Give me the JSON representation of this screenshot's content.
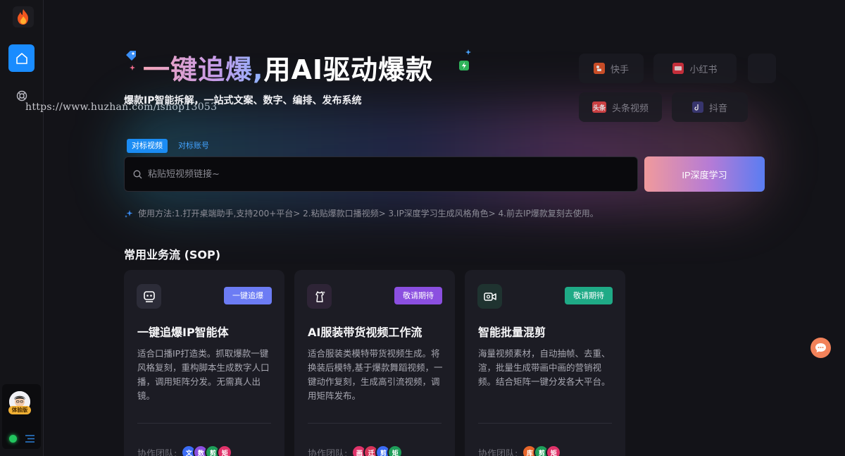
{
  "watermark": "https://www.huzhan.com/ishop13053",
  "sidebar": {
    "badge": "体验版"
  },
  "hero": {
    "title_gradient": "一键追爆,",
    "title_rest": "用AI驱动爆款",
    "subtitle": "爆款IP智能拆解，一站式文案、数字、编排、发布系统"
  },
  "platforms": [
    {
      "label": "快手",
      "icon": "kuaishou-icon",
      "color": "#e8572a"
    },
    {
      "label": "小红书",
      "icon": "xiaohongshu-icon",
      "color": "#e33340"
    },
    {
      "label": "头条视频",
      "icon": "toutiao-icon",
      "color": "#e54545"
    },
    {
      "label": "抖音",
      "icon": "douyin-icon",
      "color": "#3a3a7a"
    }
  ],
  "platform_icon_text": {
    "toutiao": "头条"
  },
  "search": {
    "tab_video": "对标视频",
    "tab_account": "对标账号",
    "placeholder": "粘贴短视频链接~",
    "button": "IP深度学习",
    "usage": "使用方法:1.打开桌端助手,支持200+平台> 2.粘贴爆款口播视频> 3.IP深度学习生成风格角色> 4.前去IP爆款复刻去使用。"
  },
  "section_title": "常用业务流 (SOP)",
  "cards": [
    {
      "title": "一键追爆IP智能体",
      "badge": "一键追爆",
      "badge_color": "#6c7cf4",
      "desc": "适合口播IP打造类。抓取爆款一键风格复刻，重构脚本生成数字人口播，调用矩阵分发。无需真人出镜。",
      "team_label": "协作团队:",
      "members": [
        "文",
        "数",
        "剪",
        "矩"
      ],
      "member_colors": [
        "#3b6cf5",
        "#8b4fe0",
        "#1f9e5a",
        "#e0336a"
      ]
    },
    {
      "title": "AI服装带货视频工作流",
      "badge": "敬请期待",
      "badge_color": "#8b4fe0",
      "desc": "适合服装类模特带货视频生成。将换装后模特,基于爆款舞蹈视频，一键动作复刻，生成高引流视频，调用矩阵发布。",
      "team_label": "协作团队:",
      "members": [
        "画",
        "迁",
        "剪",
        "矩"
      ],
      "member_colors": [
        "#e0336a",
        "#d6345a",
        "#3b6cf5",
        "#1f9e5a"
      ]
    },
    {
      "title": "智能批量混剪",
      "badge": "敬请期待",
      "badge_color": "#1faa86",
      "desc": "海量视频素材，自动抽帧、去重、渲，批量生成带画中画的营销视频。结合矩阵一键分发各大平台。",
      "team_label": "协作团队:",
      "members": [
        "库",
        "剪",
        "矩"
      ],
      "member_colors": [
        "#e8662a",
        "#1f9e5a",
        "#e0336a"
      ]
    }
  ]
}
